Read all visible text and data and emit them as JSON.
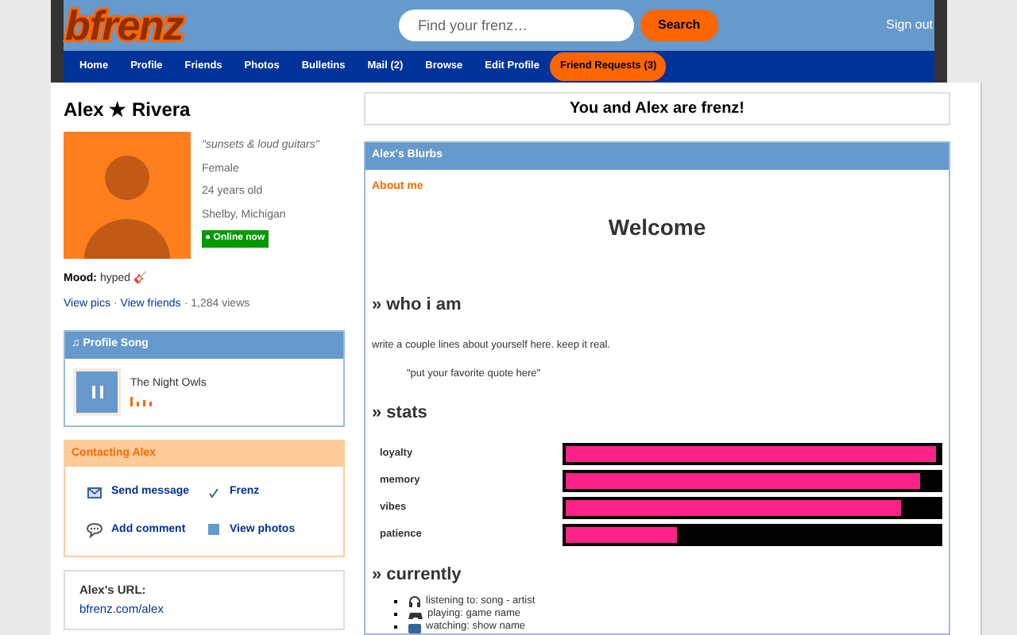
{
  "header": {
    "logo": "bfrenz",
    "search": {
      "placeholder": "Find your frenz…",
      "button": "Search"
    },
    "sign_out": "Sign out"
  },
  "nav": [
    {
      "label": "Home",
      "highlighted": false
    },
    {
      "label": "Profile",
      "highlighted": false
    },
    {
      "label": "Friends",
      "highlighted": false
    },
    {
      "label": "Photos",
      "highlighted": false
    },
    {
      "label": "Bulletins",
      "highlighted": false
    },
    {
      "label": "Mail (2)",
      "highlighted": false
    },
    {
      "label": "Browse",
      "highlighted": false
    },
    {
      "label": "Edit Profile",
      "highlighted": false
    },
    {
      "label": "Friend Requests (3)",
      "highlighted": true
    }
  ],
  "profile": {
    "name": "Alex ★ Rivera",
    "tagline": "\"sunsets & loud guitars\"",
    "details": [
      "Female",
      "24 years old",
      "Shelby, Michigan"
    ],
    "online": true,
    "online_label": "● Online now",
    "mood_label": "Mood:",
    "mood": "hyped 🎸",
    "links": [
      "View pics",
      "View friends"
    ],
    "separator": "·",
    "views": "1,284 views"
  },
  "song": {
    "title": "♫ Profile Song",
    "track": "The Night Owls",
    "playing": true
  },
  "contact": {
    "title": "Contacting Alex",
    "actions": [
      {
        "kind": "mail",
        "label": "Send message"
      },
      {
        "kind": "check",
        "label": "Frenz"
      },
      {
        "kind": "comment",
        "label": "Add comment"
      },
      {
        "kind": "photo",
        "label": "View photos"
      }
    ]
  },
  "url": {
    "label": "Alex's URL:",
    "value": "bfrenz.com/alex"
  },
  "frenz_banner": "You and Alex are frenz!",
  "blurbs": {
    "title": "Alex's Blurbs",
    "section": "About me",
    "welcome": "Welcome",
    "who_heading": "» who i am",
    "who_text": "write a couple lines about yourself here. keep it real.",
    "quote": "\"put your favorite quote here\"",
    "stats_heading": "» stats",
    "stats": [
      {
        "name": "loyalty",
        "level": 0.99
      },
      {
        "name": "memory",
        "level": 0.95
      },
      {
        "name": "vibes",
        "level": 0.9
      },
      {
        "name": "patience",
        "level": 0.3
      }
    ],
    "currently_heading": "» currently",
    "currently": [
      {
        "kind": "headphones",
        "text": "listening to: song - artist"
      },
      {
        "kind": "game",
        "text": "playing: game name"
      },
      {
        "kind": "tv",
        "text": "watching: show name"
      }
    ]
  }
}
